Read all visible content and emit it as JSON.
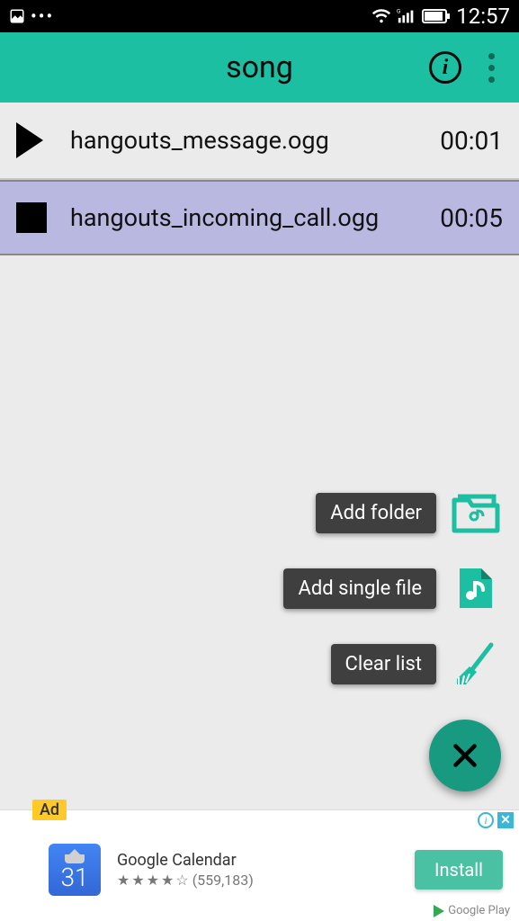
{
  "status": {
    "time": "12:57"
  },
  "header": {
    "title": "song"
  },
  "tracks": [
    {
      "name": "hangouts_message.ogg",
      "duration": "00:01",
      "state": "play"
    },
    {
      "name": "hangouts_incoming_call.ogg",
      "duration": "00:05",
      "state": "stop"
    }
  ],
  "fab": {
    "add_folder": "Add folder",
    "add_file": "Add single file",
    "clear": "Clear list"
  },
  "ad": {
    "badge": "Ad",
    "title": "Google Calendar",
    "rating_count": "(559,183)",
    "install": "Install",
    "store": "Google Play",
    "icon_day": "31"
  }
}
